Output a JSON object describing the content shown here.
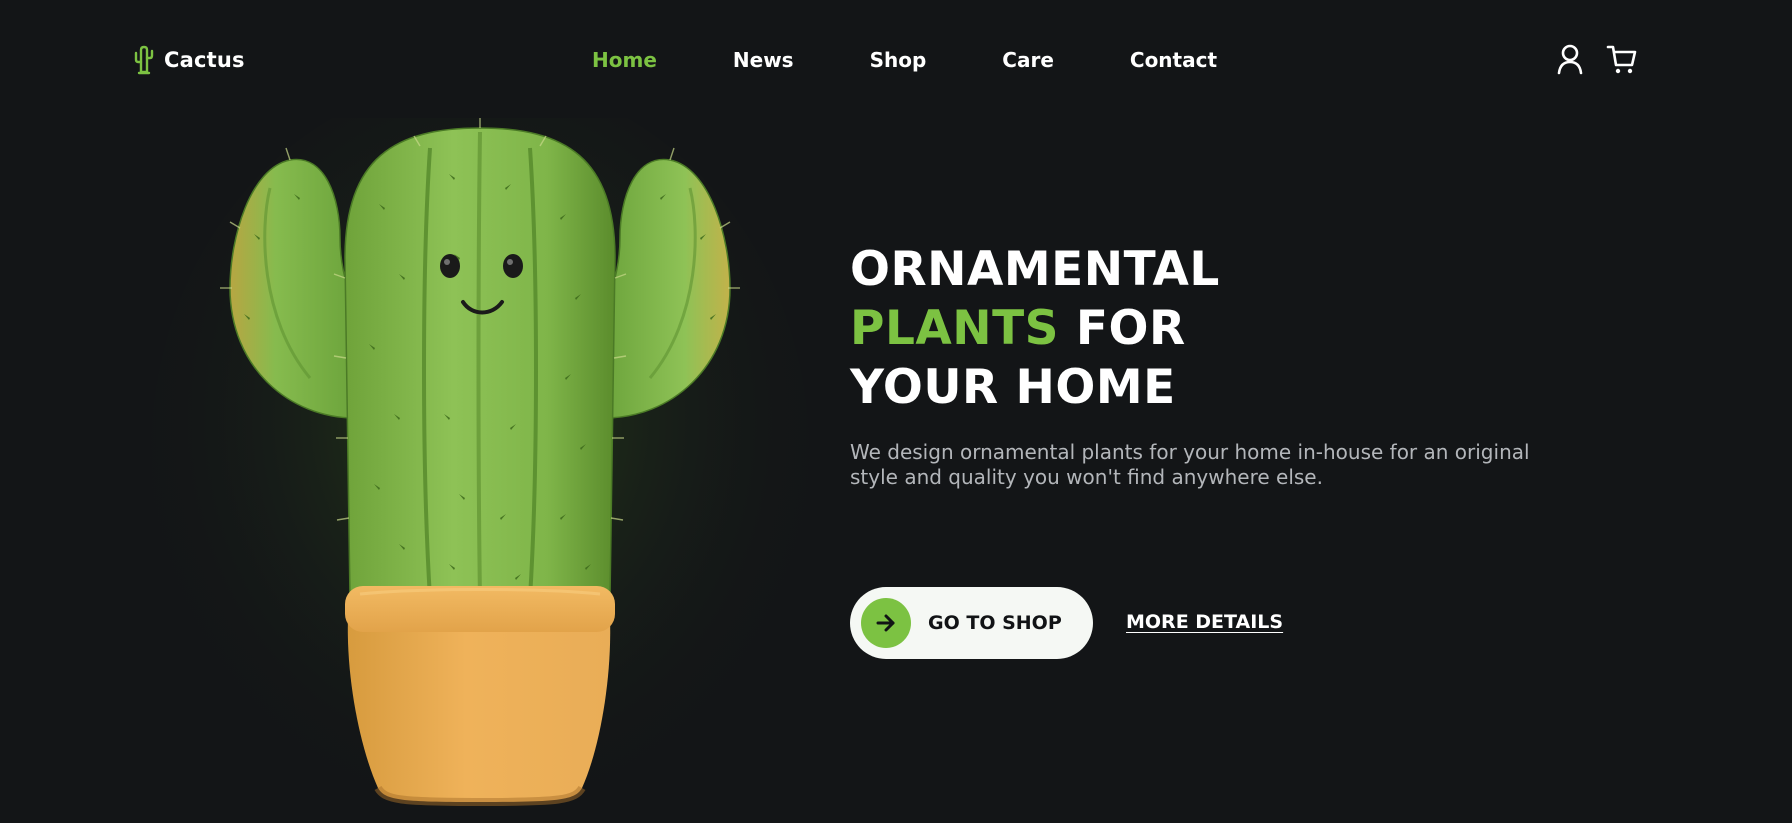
{
  "brand": {
    "name": "Cactus",
    "accent_color": "#7cc242",
    "background_color": "#131517"
  },
  "nav": {
    "items": [
      {
        "label": "Home",
        "active": true
      },
      {
        "label": "News",
        "active": false
      },
      {
        "label": "Shop",
        "active": false
      },
      {
        "label": "Care",
        "active": false
      },
      {
        "label": "Contact",
        "active": false
      }
    ]
  },
  "header_icons": [
    "user-icon",
    "cart-icon"
  ],
  "hero": {
    "title_line1": "ORNAMENTAL",
    "title_line2_accent": "PLANTS",
    "title_line2_rest": "FOR",
    "title_line3": "YOUR HOME",
    "subtitle": "We design ornamental plants for your home in-house for an original style and quality you won't find anywhere else.",
    "primary_button": {
      "label": "GO TO SHOP",
      "icon": "arrow-right-icon"
    },
    "secondary_link": "MORE DETAILS"
  }
}
